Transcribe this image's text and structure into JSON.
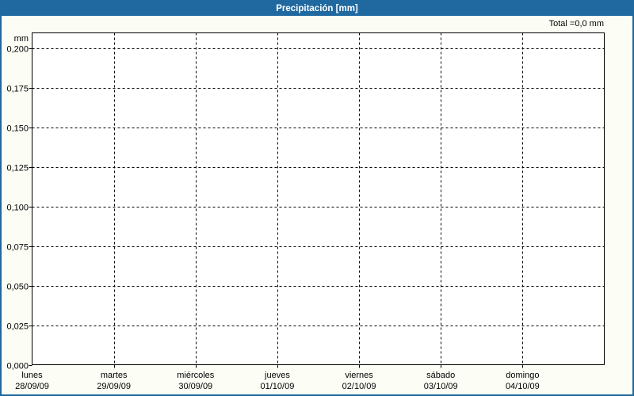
{
  "header": {
    "title": "Precipitación [mm]"
  },
  "summary": {
    "total_label": "Total =0,0 mm"
  },
  "colors": {
    "header_bg": "#2069A0",
    "frame_border": "#2069A0",
    "canvas_bg": "#FCFDF5",
    "plot_bg": "#FFFFFF",
    "grid_line": "#000000",
    "axis_line": "#000000",
    "text": "#000000",
    "title_text": "#FFFFFF"
  },
  "chart_data": {
    "type": "bar",
    "title": "Precipitación [mm]",
    "ylabel": "mm",
    "unit_label": "mm",
    "total_text": "Total =0,0 mm",
    "total_value_mm": 0.0,
    "grid": "dashed",
    "legend": "none",
    "ylim": [
      0,
      0.21
    ],
    "y_ticks": [
      {
        "value": 0.0,
        "label": "0,000"
      },
      {
        "value": 0.025,
        "label": "0,025"
      },
      {
        "value": 0.05,
        "label": "0,050"
      },
      {
        "value": 0.075,
        "label": "0,075"
      },
      {
        "value": 0.1,
        "label": "0,100"
      },
      {
        "value": 0.125,
        "label": "0,125"
      },
      {
        "value": 0.15,
        "label": "0,150"
      },
      {
        "value": 0.175,
        "label": "0,175"
      },
      {
        "value": 0.2,
        "label": "0,200"
      }
    ],
    "categories": [
      {
        "day": "lunes",
        "date": "28/09/09"
      },
      {
        "day": "martes",
        "date": "29/09/09"
      },
      {
        "day": "miércoles",
        "date": "30/09/09"
      },
      {
        "day": "jueves",
        "date": "01/10/09"
      },
      {
        "day": "viernes",
        "date": "02/10/09"
      },
      {
        "day": "sábado",
        "date": "03/10/09"
      },
      {
        "day": "domingo",
        "date": "04/10/09"
      }
    ],
    "values": [
      0,
      0,
      0,
      0,
      0,
      0,
      0
    ]
  }
}
